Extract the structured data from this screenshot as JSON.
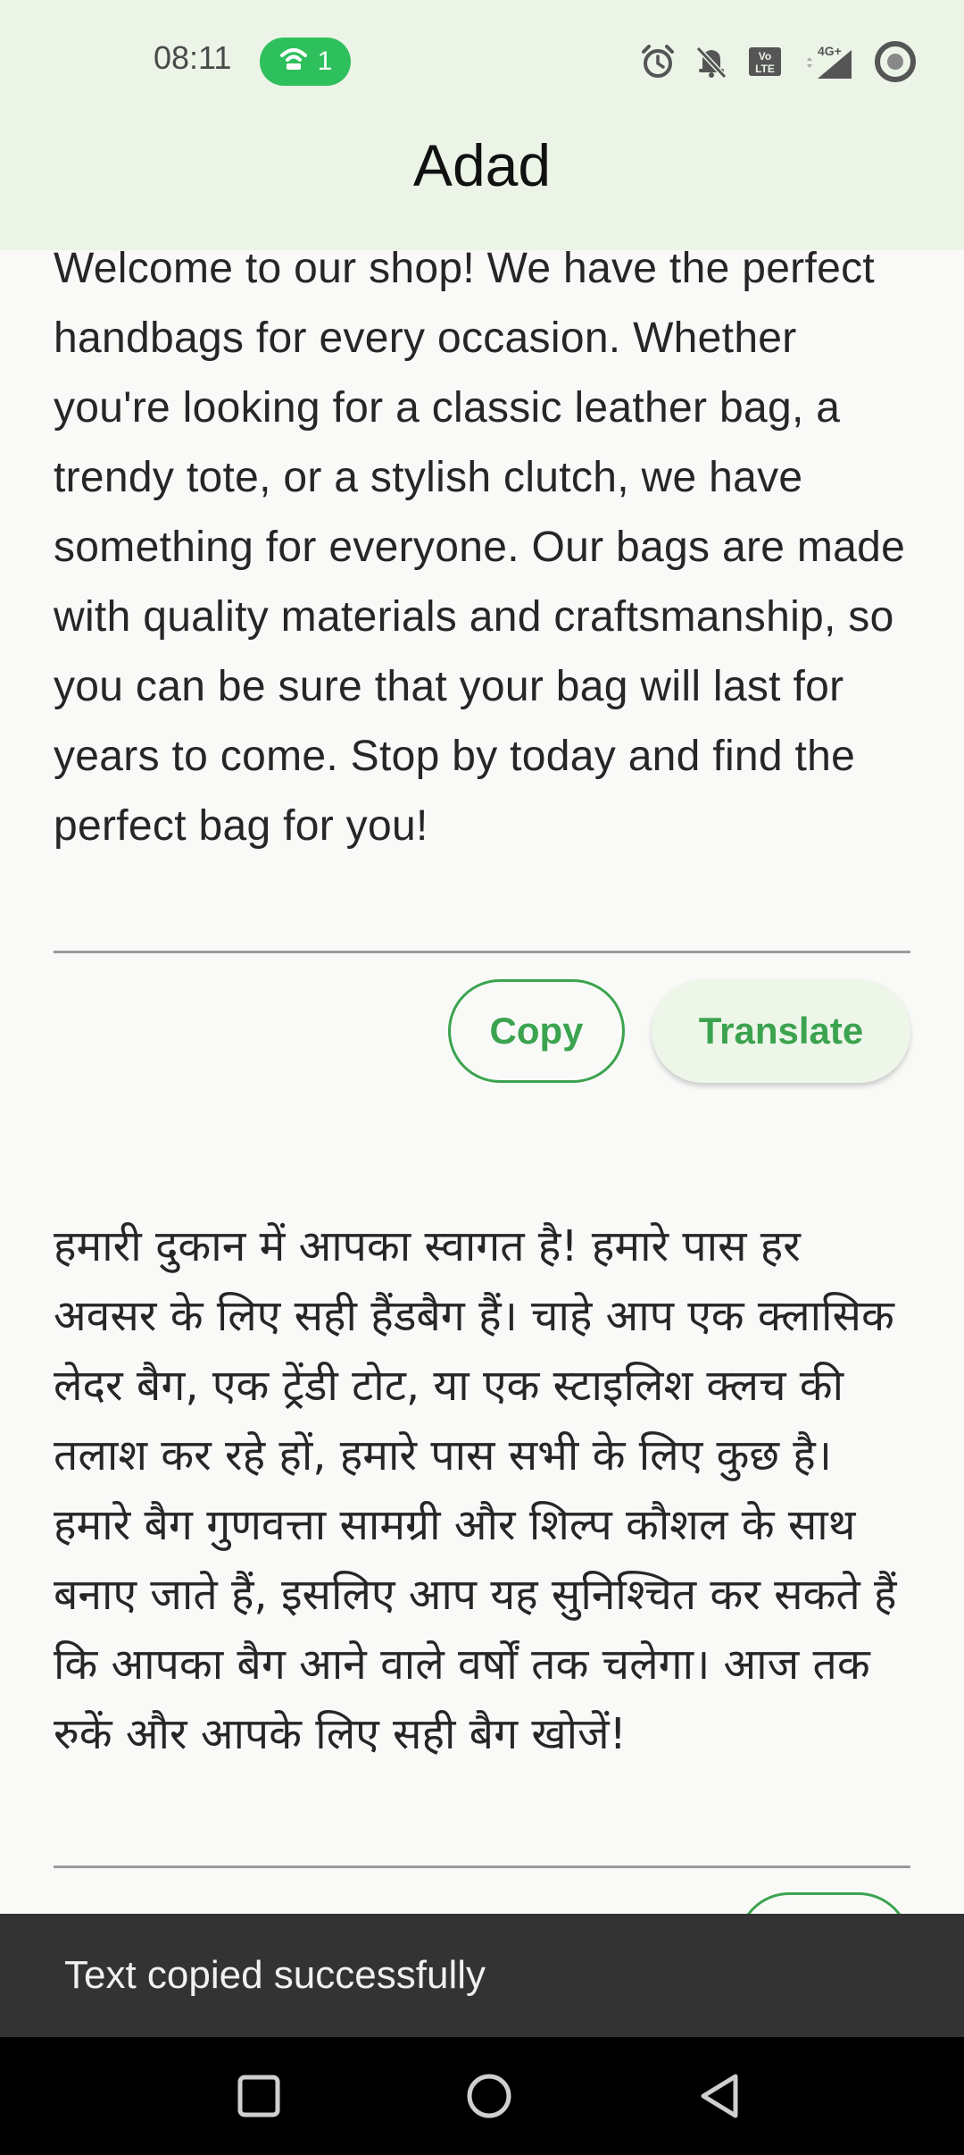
{
  "status_bar": {
    "time": "08:11",
    "hotspot_count": "1",
    "icons": [
      "alarm-icon",
      "mute-icon",
      "volte-icon",
      "signal-4g-icon",
      "battery-icon"
    ],
    "network_label": "4G+",
    "volte_label": "Vo LTE"
  },
  "app_bar": {
    "title": "Adad"
  },
  "original": {
    "text": "Welcome to our shop! We have the perfect handbags for every occasion. Whether you're looking for a classic leather bag, a trendy tote, or a stylish clutch, we have something for everyone. Our bags are made with quality materials and craftsmanship, so you can be sure that your bag will last for years to come. Stop by today and find the perfect bag for you!",
    "copy_label": "Copy",
    "translate_label": "Translate"
  },
  "translation": {
    "text": "हमारी दुकान में आपका स्वागत है! हमारे पास हर अवसर के लिए सही हैंडबैग हैं। चाहे आप एक क्लासिक लेदर बैग, एक ट्रेंडी टोट, या एक स्टाइलिश क्लच की तलाश कर रहे हों, हमारे पास सभी के लिए कुछ है। हमारे बैग गुणवत्ता सामग्री और शिल्प कौशल के साथ बनाए जाते हैं, इसलिए आप यह सुनिश्चित कर सकते हैं कि आपका बैग आने वाले वर्षों तक चलेगा। आज तक रुकें और आपके लिए सही बैग खोजें!"
  },
  "snackbar": {
    "message": "Text copied successfully"
  },
  "nav_bar": {
    "buttons": [
      "recents-icon",
      "home-icon",
      "back-icon"
    ]
  },
  "colors": {
    "accent": "#3ca34f",
    "app_bar_bg": "#ebf4e7",
    "hotspot_bg": "#2ec05c",
    "snackbar_bg": "#333333"
  }
}
